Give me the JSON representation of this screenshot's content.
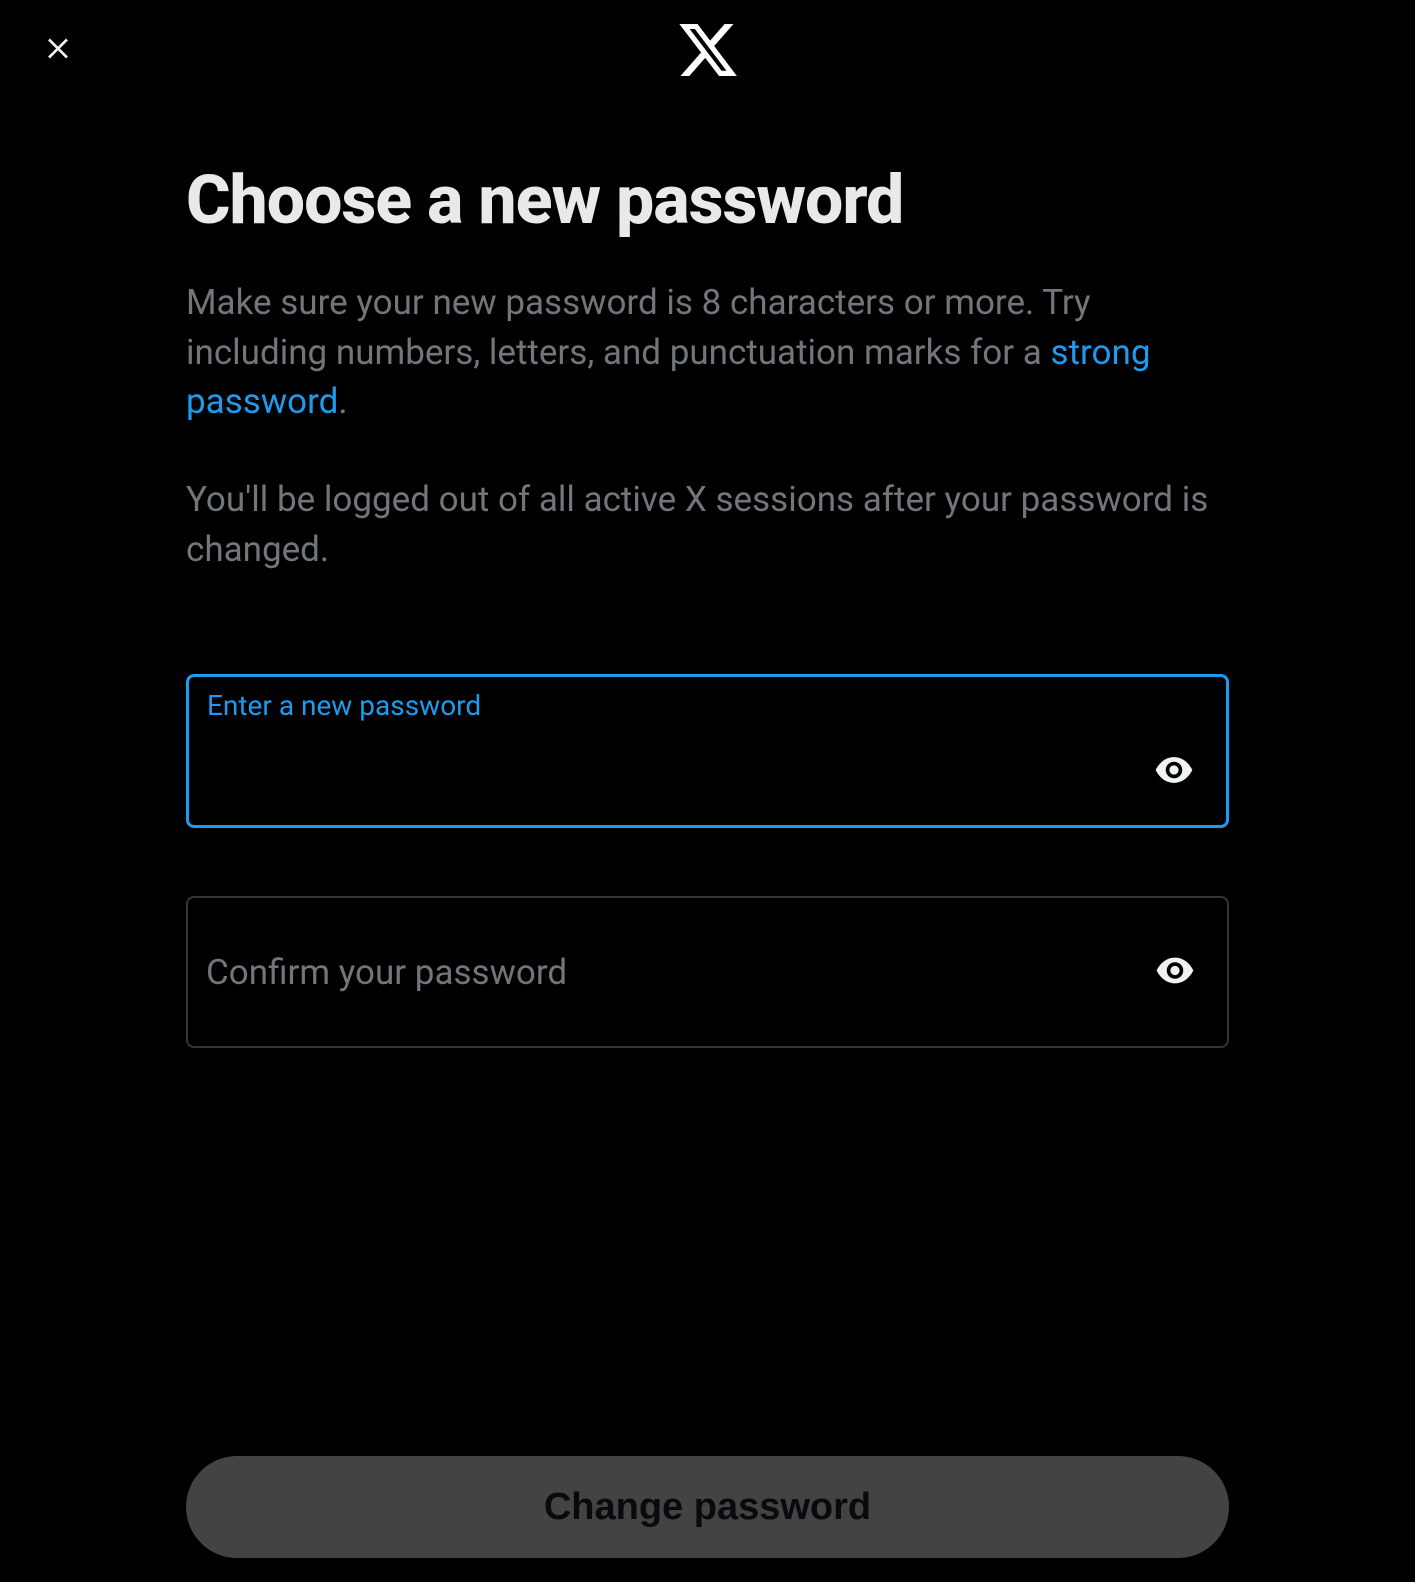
{
  "header": {
    "close_label": "Close"
  },
  "main": {
    "title": "Choose a new password",
    "description_prefix": "Make sure your new password is 8 characters or more. Try including numbers, letters, and punctuation marks for a ",
    "description_link": "strong password",
    "description_suffix": ".",
    "logout_notice": "You'll be logged out of all active X sessions after your password is changed."
  },
  "fields": {
    "new_password": {
      "label": "Enter a new password",
      "value": ""
    },
    "confirm_password": {
      "label": "Confirm your password",
      "value": ""
    }
  },
  "submit": {
    "label": "Change password"
  },
  "colors": {
    "background": "#000000",
    "text_primary": "#e7e9ea",
    "text_secondary": "#71767b",
    "accent": "#1d9bf0",
    "border": "#333639",
    "button_bg": "#787a7a"
  }
}
